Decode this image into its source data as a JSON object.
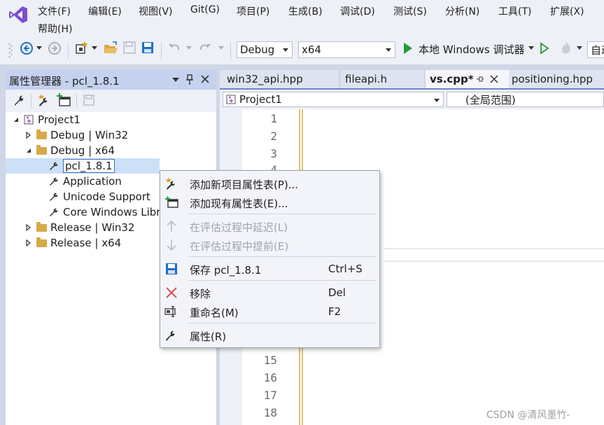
{
  "menu": {
    "items": [
      "文件(F)",
      "编辑(E)",
      "视图(V)",
      "Git(G)",
      "项目(P)",
      "生成(B)",
      "调试(D)",
      "测试(S)",
      "分析(N)",
      "工具(T)",
      "扩展(X)"
    ],
    "help": "帮助(H)"
  },
  "toolbar": {
    "config": "Debug",
    "platform": "x64",
    "run_label": "本地 Windows 调试器",
    "auto_label": "自动"
  },
  "property_manager": {
    "title": "属性管理器 - pcl_1.8.1",
    "tree": [
      {
        "label": "Project1"
      },
      {
        "label": "Debug | Win32"
      },
      {
        "label": "Debug | x64"
      },
      {
        "label": "pcl_1.8.1"
      },
      {
        "label": "Application"
      },
      {
        "label": "Unicode Support"
      },
      {
        "label": "Core Windows Libr"
      },
      {
        "label": "Release | Win32"
      },
      {
        "label": "Release | x64"
      }
    ]
  },
  "editor": {
    "tabs": [
      "win32_api.hpp",
      "fileapi.h",
      "vs.cpp*",
      "positioning.hpp"
    ],
    "project_combo": "Project1",
    "scope_combo": "(全局范围)",
    "line_numbers": [
      "1",
      "2",
      "3",
      "4",
      "15",
      "16",
      "17",
      "18"
    ]
  },
  "context_menu": {
    "items": [
      {
        "label": "添加新项目属性表(P)...",
        "shortcut": "",
        "icon": "new-property-sheet-icon"
      },
      {
        "label": "添加现有属性表(E)...",
        "shortcut": "",
        "icon": "add-existing-sheet-icon"
      },
      {
        "label": "在评估过程中延迟(L)",
        "shortcut": "",
        "icon": "arrow-up-icon"
      },
      {
        "label": "在评估过程中提前(E)",
        "shortcut": "",
        "icon": "arrow-down-icon"
      },
      {
        "label": "保存 pcl_1.8.1",
        "shortcut": "Ctrl+S",
        "icon": "save-icon"
      },
      {
        "label": "移除",
        "shortcut": "Del",
        "icon": "remove-icon"
      },
      {
        "label": "重命名(M)",
        "shortcut": "F2",
        "icon": "rename-icon"
      },
      {
        "label": "属性(R)",
        "shortcut": "",
        "icon": "wrench-icon"
      }
    ]
  },
  "watermark": "CSDN @清风墨竹-",
  "colors": {
    "accent": "#6b84c9",
    "panel_title": "#c5d1ee",
    "selection": "#cce0f7",
    "remove_red": "#d9534f",
    "save_blue": "#1e6ec8"
  }
}
